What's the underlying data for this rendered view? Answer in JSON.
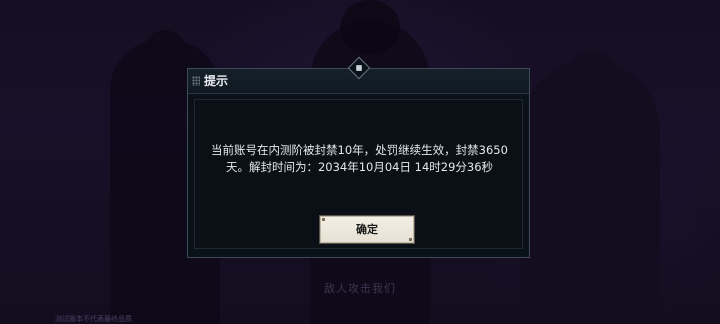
{
  "background": {
    "caption": "敌人攻击我们",
    "watermark": "测试版本不代表最终品质"
  },
  "dialog": {
    "title": "提示",
    "message_line1": "当前账号在内测阶被封禁10年，处罚继续生效，封禁3650",
    "message_line2": "天。解封时间为：2034年10月04日 14时29分36秒",
    "confirm_label": "确定"
  },
  "icons": {
    "emblem": "diamond-emblem-icon",
    "grip": "grip-dots-icon"
  },
  "colors": {
    "dialog_bg": "#0b1118",
    "dialog_border": "#3f4a57",
    "button_bg": "#f0ebe1",
    "text": "#e4e8ec"
  }
}
